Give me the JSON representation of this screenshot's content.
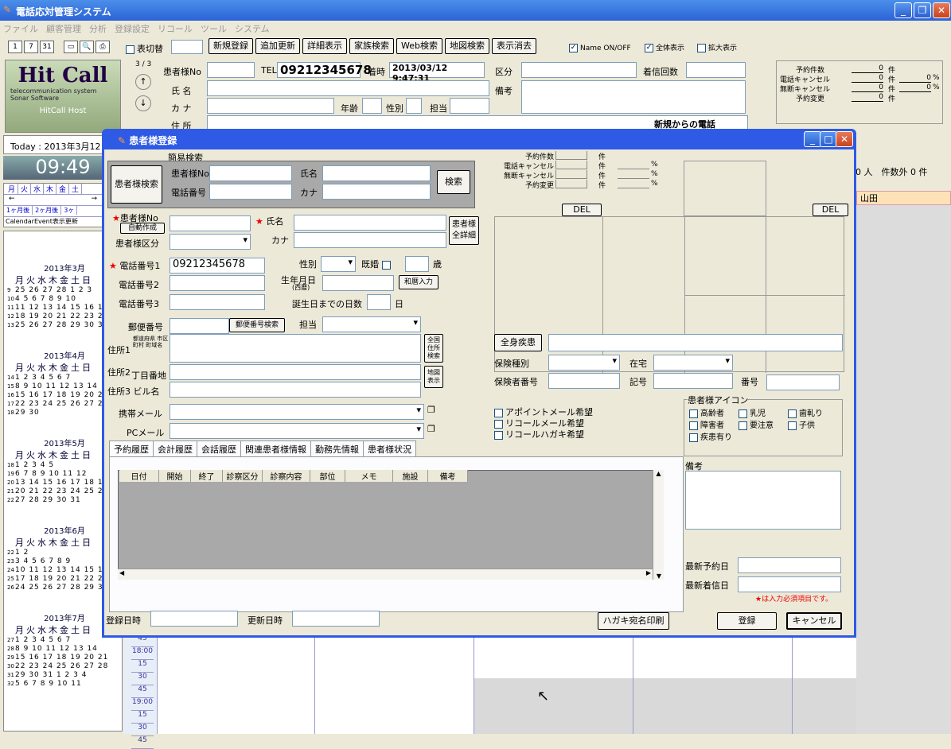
{
  "app": {
    "title": "電話応対管理システム",
    "menu": [
      "ファイル",
      "顧客管理",
      "分析",
      "登録設定",
      "リコール",
      "ツール",
      "システム"
    ]
  },
  "toolbar": {
    "icons": [
      "calendar-1-icon",
      "calendar-7-icon",
      "calendar-31-icon",
      "window-icon",
      "preview-icon",
      "print-icon"
    ],
    "hyouki": "表切替",
    "buttons": [
      "新規登録",
      "追加更新",
      "詳細表示",
      "家族検索",
      "Web検索",
      "地図検索",
      "表示消去"
    ],
    "name_onoff": "Name ON/OFF",
    "zentai": "全体表示",
    "kakudai": "拡大表示"
  },
  "logo": {
    "title": "Hit Call",
    "sub1": "telecommunication system",
    "sub2": "Sonar Software",
    "host": "HitCall Host"
  },
  "main": {
    "counter": "3 / 3",
    "kanja_no": "患者様No",
    "tel_label": "TEL",
    "tel": "09212345678",
    "chakuji_label": "着時",
    "chakuji": "2013/03/12 9:47:31",
    "kubun": "区分",
    "bikou": "備考",
    "chakushin": "着信回数",
    "shimei": "氏 名",
    "kana": "カ ナ",
    "nenrei": "年齢",
    "seibetsu": "性別",
    "tantou": "担当",
    "jusho": "住 所",
    "new_call": "新規からの電話",
    "today": "Today : 2013年3月12",
    "clock": "09:49",
    "right_count": "0 人　件数外 0 件",
    "yamada": "山田"
  },
  "stats": {
    "yoyaku": "予約件数",
    "denwa": "電話キャンセル",
    "mudan": "無断キャンセル",
    "henkou": "予約変更",
    "ken": "件",
    "zero": "0",
    "pct": "%",
    "pct_val": "0"
  },
  "left": {
    "days": [
      "月",
      "火",
      "水",
      "木",
      "金",
      "土"
    ],
    "arrow_l": "←",
    "arrow_r": "→",
    "month_btns": [
      "1ヶ月後",
      "2ヶ月後",
      "3ヶ"
    ],
    "cal_event": "CalendarEvent表示更新"
  },
  "months": [
    {
      "title": "2013年3月",
      "rows": [
        [
          "9",
          "25 26 27 28 1 2 3"
        ],
        [
          "10",
          "4 5 6 7 8 9 10"
        ],
        [
          "11",
          "11 12 13 14 15 16 17"
        ],
        [
          "12",
          "18 19 20 21 22 23 24"
        ],
        [
          "13",
          "25 26 27 28 29 30 31"
        ]
      ]
    },
    {
      "title": "2013年4月",
      "rows": [
        [
          "14",
          "1 2 3 4 5 6 7"
        ],
        [
          "15",
          "8 9 10 11 12 13 14"
        ],
        [
          "16",
          "15 16 17 18 19 20 21"
        ],
        [
          "17",
          "22 23 24 25 26 27 28"
        ],
        [
          "18",
          "29 30"
        ]
      ]
    },
    {
      "title": "2013年5月",
      "rows": [
        [
          "18",
          "1 2 3 4 5"
        ],
        [
          "19",
          "6 7 8 9 10 11 12"
        ],
        [
          "20",
          "13 14 15 16 17 18 19"
        ],
        [
          "21",
          "20 21 22 23 24 25 26"
        ],
        [
          "22",
          "27 28 29 30 31"
        ]
      ]
    },
    {
      "title": "2013年6月",
      "rows": [
        [
          "22",
          "1 2"
        ],
        [
          "23",
          "3 4 5 6 7 8 9"
        ],
        [
          "24",
          "10 11 12 13 14 15 16"
        ],
        [
          "25",
          "17 18 19 20 21 22 23"
        ],
        [
          "26",
          "24 25 26 27 28 29 30"
        ]
      ]
    },
    {
      "title": "2013年7月",
      "rows": [
        [
          "27",
          "1 2 3 4 5 6 7"
        ],
        [
          "28",
          "8 9 10 11 12 13 14"
        ],
        [
          "29",
          "15 16 17 18 19 20 21"
        ],
        [
          "30",
          "22 23 24 25 26 27 28"
        ],
        [
          "31",
          "29 30 31 1 2 3 4"
        ],
        [
          "32",
          "5 6 7 8 9 10 11"
        ]
      ]
    }
  ],
  "weekhdr": "月火水木金土日",
  "times": [
    "45",
    "18:00",
    "15",
    "30",
    "45",
    "19:00",
    "15",
    "30",
    "45"
  ],
  "dialog": {
    "title": "患者様登録",
    "kani": "簡易検索",
    "kanja_kensaku": "患者様検索",
    "kanja_no": "患者様No",
    "shimei": "氏名",
    "denwa": "電話番号",
    "kana": "カナ",
    "kensaku": "検索",
    "no_label": "患者様No",
    "jidou": "自動作成",
    "name_label": "氏名",
    "kana2": "カナ",
    "kubun": "患者様区分",
    "zen_shousai": "患者様全詳細",
    "tel1": "電話番号1",
    "tel1_val": "09212345678",
    "tel2": "電話番号2",
    "tel3": "電話番号3",
    "seibetsu": "性別",
    "kikon": "既婚",
    "sai": "歳",
    "birth": "生年月日",
    "seireki": "(西暦)",
    "wareki": "和暦入力",
    "tanjoubi": "誕生日までの日数",
    "nichi": "日",
    "yubin": "郵便番号",
    "yubin_btn": "郵便番号検索",
    "tantou": "担当",
    "addr1": "住所1",
    "addr1_sub": "都道府県 市区町村 町域名",
    "addr2": "住所2",
    "addr2_sub": "丁目番地",
    "addr3": "住所3 ビル名",
    "zenkoku": "全国住所検索",
    "chizu": "地図表示",
    "keitai": "携帯メール",
    "pc": "PCメール",
    "zenshin": "全身疾患",
    "hoken_shubetsu": "保険種別",
    "zaitaku": "在宅",
    "hokensha": "保険者番号",
    "kigou": "記号",
    "bangou": "番号",
    "appoint": "アポイントメール希望",
    "recall_mail": "リコールメール希望",
    "recall_hagaki": "リコールハガキ希望",
    "icon_title": "患者様アイコン",
    "icons": [
      "高齢者",
      "乳児",
      "歯軋り",
      "障害者",
      "要注意",
      "子供",
      "疾患有り"
    ],
    "tabs": [
      "予約履歴",
      "会計履歴",
      "会話履歴",
      "関連患者様情報",
      "勤務先情報",
      "患者様状況"
    ],
    "cols": [
      "日付",
      "開始",
      "終了",
      "診察区分",
      "診察内容",
      "部位",
      "メモ",
      "施設",
      "備考"
    ],
    "bikou": "備考",
    "saishin_yoyaku": "最新予約日",
    "saishin_chaku": "最新着信日",
    "required": "★は入力必須項目です。",
    "touroku_date": "登録日時",
    "koushin_date": "更新日時",
    "hagaki": "ハガキ宛名印刷",
    "touroku": "登録",
    "cancel": "キャンセル",
    "del": "DEL",
    "stats_yoyaku": "予約件数",
    "stats_denwa": "電話キャンセル",
    "stats_mudan": "無断キャンセル",
    "stats_henkou": "予約変更",
    "ken": "件",
    "pct": "%"
  }
}
